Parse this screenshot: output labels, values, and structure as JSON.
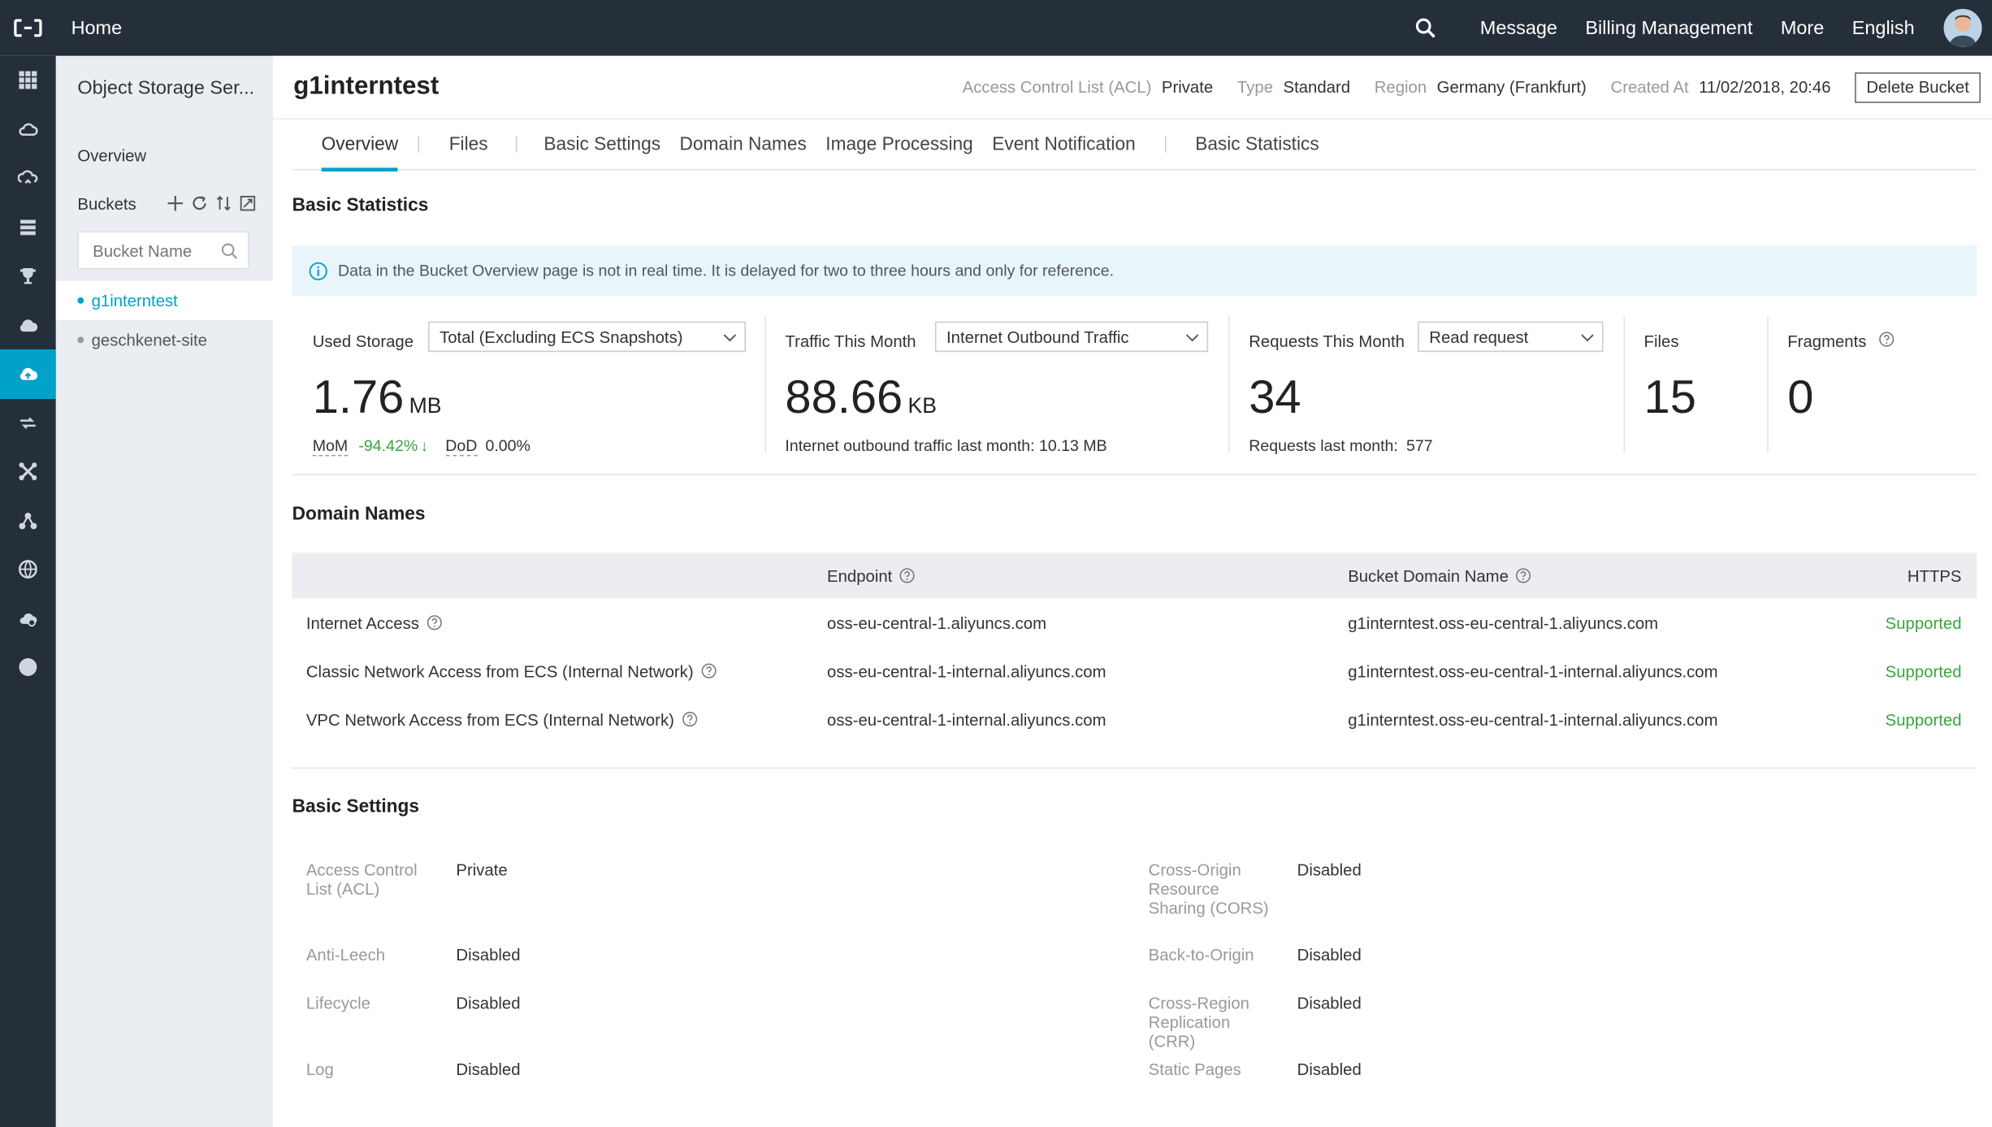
{
  "topbar": {
    "home": "Home",
    "links": [
      "Message",
      "Billing Management",
      "More",
      "English"
    ]
  },
  "rail_icons": [
    "apps-grid-icon",
    "cloud-icon",
    "cloud-sync-icon",
    "database-icon",
    "trophy-icon",
    "cloud-up-icon",
    "oss-icon",
    "route-icon",
    "scissors-icon",
    "network-icon",
    "globe-icon",
    "cloud-gear-icon",
    "circle-icon"
  ],
  "sidebar": {
    "title": "Object Storage Ser...",
    "overview": "Overview",
    "buckets_label": "Buckets",
    "search_placeholder": "Bucket Name",
    "buckets": [
      "g1interntest",
      "geschkenet-site"
    ]
  },
  "header": {
    "bucket_name": "g1interntest",
    "acl_label": "Access Control List (ACL)",
    "acl_value": "Private",
    "type_label": "Type",
    "type_value": "Standard",
    "region_label": "Region",
    "region_value": "Germany (Frankfurt)",
    "created_label": "Created At",
    "created_value": "11/02/2018, 20:46",
    "delete_button": "Delete Bucket"
  },
  "tabs": [
    "Overview",
    "Files",
    "Basic Settings",
    "Domain Names",
    "Image Processing",
    "Event Notification",
    "Basic Statistics"
  ],
  "basic_statistics": {
    "title": "Basic Statistics",
    "notice": "Data in the Bucket Overview page is not in real time. It is delayed for two to three hours and only for reference.",
    "used_storage": {
      "label": "Used Storage",
      "select": "Total (Excluding ECS Snapshots)",
      "value": "1.76",
      "unit": "MB",
      "mom_label": "MoM",
      "mom_value": "-94.42%",
      "mom_arrow": "↓",
      "dod_label": "DoD",
      "dod_value": "0.00%"
    },
    "traffic": {
      "label": "Traffic This Month",
      "select": "Internet Outbound Traffic",
      "value": "88.66",
      "unit": "KB",
      "sub": "Internet outbound traffic last month: 10.13 MB"
    },
    "requests": {
      "label": "Requests This Month",
      "select": "Read request",
      "value": "34",
      "sub_label": "Requests last month:",
      "sub_value": "577"
    },
    "files": {
      "label": "Files",
      "value": "15"
    },
    "fragments": {
      "label": "Fragments",
      "value": "0"
    }
  },
  "domain_names": {
    "title": "Domain Names",
    "columns": [
      "Endpoint",
      "Bucket Domain Name",
      "HTTPS"
    ],
    "rows": [
      {
        "type": "Internet Access",
        "endpoint": "oss-eu-central-1.aliyuncs.com",
        "domain": "g1interntest.oss-eu-central-1.aliyuncs.com",
        "https": "Supported"
      },
      {
        "type": "Classic Network Access from ECS (Internal Network)",
        "endpoint": "oss-eu-central-1-internal.aliyuncs.com",
        "domain": "g1interntest.oss-eu-central-1-internal.aliyuncs.com",
        "https": "Supported"
      },
      {
        "type": "VPC Network Access from ECS (Internal Network)",
        "endpoint": "oss-eu-central-1-internal.aliyuncs.com",
        "domain": "g1interntest.oss-eu-central-1-internal.aliyuncs.com",
        "https": "Supported"
      }
    ]
  },
  "basic_settings": {
    "title": "Basic Settings",
    "left": [
      {
        "key": "Access Control List (ACL)",
        "value": "Private"
      },
      {
        "key": "Anti-Leech",
        "value": "Disabled"
      },
      {
        "key": "Lifecycle",
        "value": "Disabled"
      },
      {
        "key": "Log",
        "value": "Disabled"
      }
    ],
    "right": [
      {
        "key": "Cross-Origin Resource Sharing (CORS)",
        "value": "Disabled"
      },
      {
        "key": "Back-to-Origin",
        "value": "Disabled"
      },
      {
        "key": "Cross-Region Replication (CRR)",
        "value": "Disabled"
      },
      {
        "key": "Static Pages",
        "value": "Disabled"
      }
    ]
  },
  "colors": {
    "topbar": "#242f3a",
    "accent": "#00a2ca",
    "sidebar": "#eaedf1",
    "supported": "#3aa53a"
  }
}
